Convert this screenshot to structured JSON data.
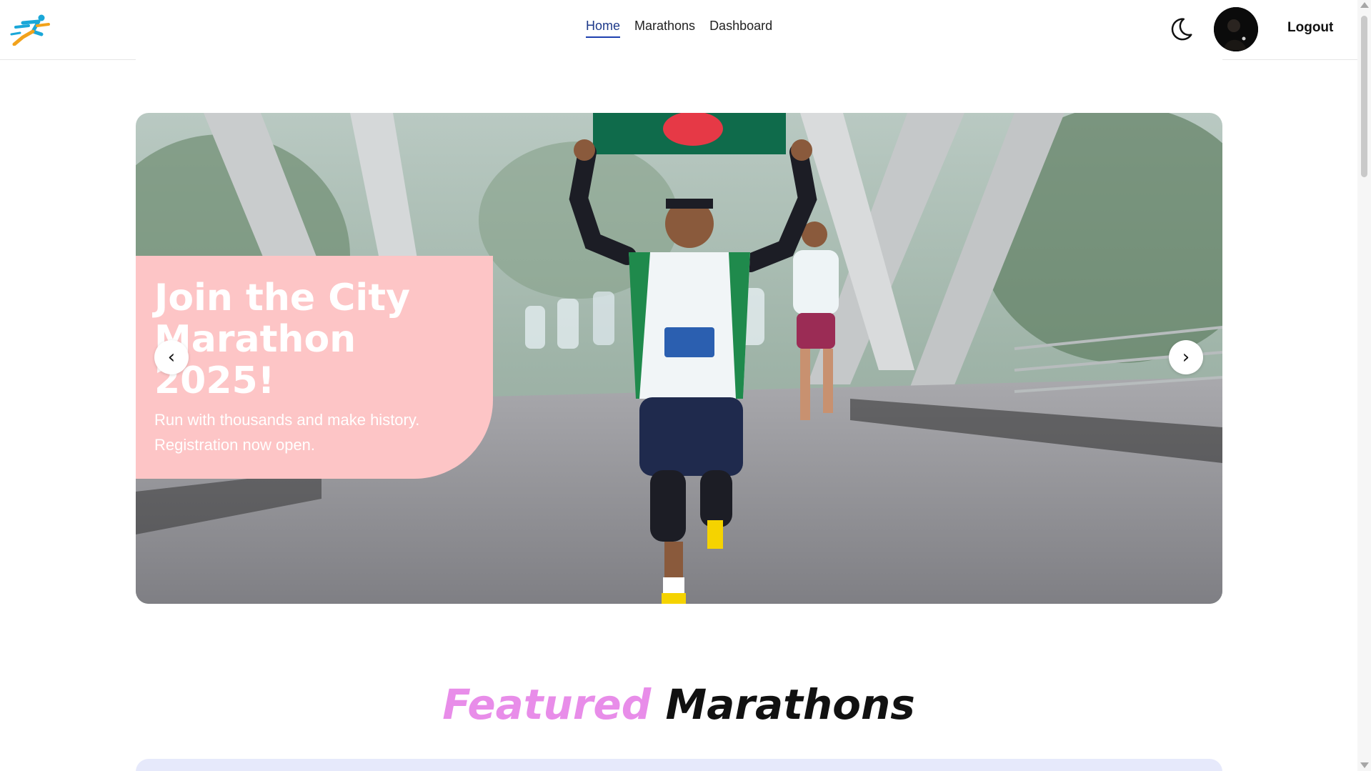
{
  "navbar": {
    "links": [
      {
        "label": "Home",
        "active": true
      },
      {
        "label": "Marathons",
        "active": false
      },
      {
        "label": "Dashboard",
        "active": false
      }
    ],
    "logout_label": "Logout",
    "icons": {
      "logo": "runner-logo-icon",
      "theme": "moon-icon",
      "avatar": "user-avatar"
    }
  },
  "hero": {
    "title": "Join the City Marathon 2025!",
    "subtitle": "Run with thousands and make history. Registration now open.",
    "prev_symbol": "‹",
    "next_symbol": "›",
    "caption_color": "#fdc5c6"
  },
  "featured": {
    "accent_word": "Featured",
    "rest_word": "Marathons",
    "accent_color": "#e88de9"
  }
}
